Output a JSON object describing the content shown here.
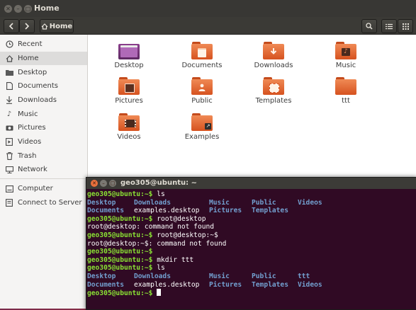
{
  "files_window": {
    "title": "Home",
    "path_button": "Home",
    "sidebar": [
      {
        "label": "Recent",
        "icon": "clock-icon"
      },
      {
        "label": "Home",
        "icon": "home-icon",
        "active": true
      },
      {
        "label": "Desktop",
        "icon": "folder-icon"
      },
      {
        "label": "Documents",
        "icon": "document-icon"
      },
      {
        "label": "Downloads",
        "icon": "download-icon"
      },
      {
        "label": "Music",
        "icon": "music-icon"
      },
      {
        "label": "Pictures",
        "icon": "camera-icon"
      },
      {
        "label": "Videos",
        "icon": "video-icon"
      },
      {
        "label": "Trash",
        "icon": "trash-icon"
      },
      {
        "label": "Network",
        "icon": "network-icon"
      },
      {
        "label": "Computer",
        "icon": "computer-icon"
      },
      {
        "label": "Connect to Server",
        "icon": "server-icon"
      }
    ],
    "items": [
      {
        "label": "Desktop"
      },
      {
        "label": "Documents"
      },
      {
        "label": "Downloads"
      },
      {
        "label": "Music"
      },
      {
        "label": "Pictures"
      },
      {
        "label": "Public"
      },
      {
        "label": "Templates"
      },
      {
        "label": "ttt"
      },
      {
        "label": "Videos"
      },
      {
        "label": "Examples"
      }
    ]
  },
  "terminal": {
    "title": "geo305@ubuntu: ~",
    "prompt": "geo305@ubuntu:~$",
    "lines": {
      "l1_cmd": " ls",
      "l2": [
        "Desktop",
        "Downloads",
        "Music",
        "Public",
        "Videos"
      ],
      "l3": [
        "Documents",
        "examples.desktop",
        "Pictures",
        "Templates"
      ],
      "l4_cmd": " root@desktop",
      "l5": "root@desktop: command not found",
      "l6_cmd": " root@desktop:~$",
      "l7": "root@desktop:~$: command not found",
      "l8_cmd": "",
      "l9_cmd": " mkdir ttt",
      "l10_cmd": " ls",
      "l11": [
        "Desktop",
        "Downloads",
        "Music",
        "Public",
        "ttt"
      ],
      "l12": [
        "Documents",
        "examples.desktop",
        "Pictures",
        "Templates",
        "Videos"
      ]
    }
  },
  "colors": {
    "terminal_bg": "#300a24",
    "prompt": "#8ae234",
    "dir": "#729fcf",
    "folder": "#e9703c"
  }
}
